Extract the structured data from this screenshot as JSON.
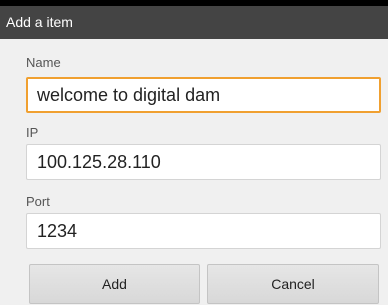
{
  "dialog": {
    "title": "Add a item"
  },
  "fields": {
    "name": {
      "label": "Name",
      "value": "welcome to digital dam"
    },
    "ip": {
      "label": "IP",
      "value": "100.125.28.110"
    },
    "port": {
      "label": "Port",
      "value": "1234"
    }
  },
  "buttons": {
    "add_label": "Add",
    "cancel_label": "Cancel"
  },
  "colors": {
    "title_bar": "#444444",
    "focus_border": "#f0a030"
  }
}
